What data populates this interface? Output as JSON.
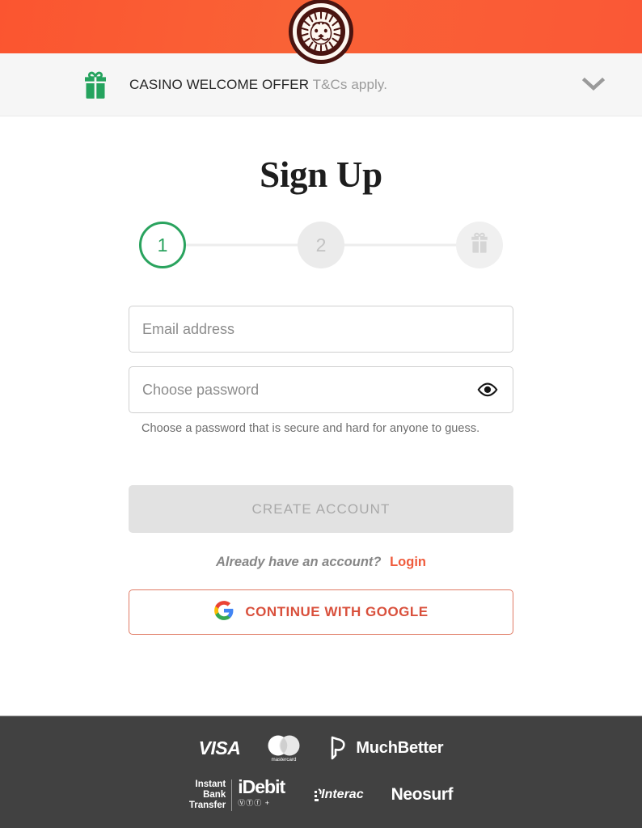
{
  "brand": {
    "logo_icon": "lion-head-logo",
    "accent_orange": "#fa5836",
    "green": "#2aa35e",
    "link_orange": "#ef5b3c"
  },
  "offer_bar": {
    "gift_icon": "gift-icon",
    "title": "CASINO WELCOME OFFER",
    "tcs": "T&Cs apply.",
    "expand_icon": "chevron-down-icon"
  },
  "main": {
    "title": "Sign Up",
    "steps": [
      {
        "label": "1",
        "state": "active"
      },
      {
        "label": "2",
        "state": "inactive"
      },
      {
        "label": "",
        "state": "inactive",
        "icon": "gift-icon"
      }
    ],
    "email": {
      "placeholder": "Email address",
      "value": ""
    },
    "password": {
      "placeholder": "Choose password",
      "value": "",
      "toggle_icon": "eye-icon",
      "helper": "Choose a password that is secure and hard for anyone to guess."
    },
    "submit_label": "CREATE ACCOUNT",
    "login_prompt": "Already have an account?",
    "login_link": "Login",
    "google_label": "CONTINUE WITH GOOGLE",
    "google_icon": "google-g-icon"
  },
  "footer": {
    "row1": [
      {
        "name": "visa-logo",
        "text": "VISA"
      },
      {
        "name": "mastercard-logo",
        "text": "mastercard"
      },
      {
        "name": "muchbetter-logo",
        "text": "MuchBetter"
      }
    ],
    "row2": [
      {
        "name": "instant-bank-transfer-logo",
        "line1": "Instant",
        "line2": "Bank",
        "line3": "Transfer"
      },
      {
        "name": "idebit-logo",
        "text": "iDebit"
      },
      {
        "name": "interac-logo",
        "text": "Interac"
      },
      {
        "name": "neosurf-logo",
        "text": "Neosurf"
      }
    ]
  }
}
